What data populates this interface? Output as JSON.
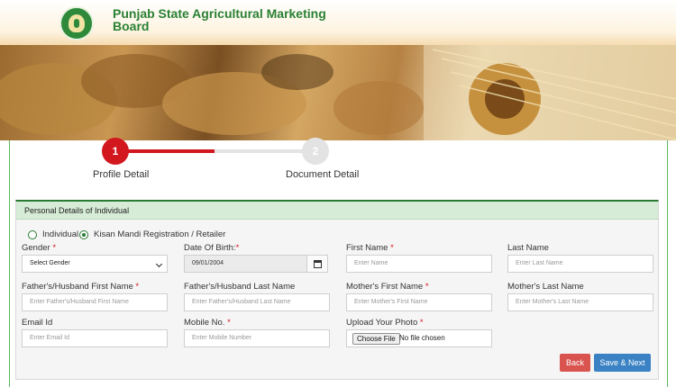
{
  "header": {
    "title": "Punjab State Agricultural Marketing Board"
  },
  "wizard": {
    "steps": [
      {
        "number": "1",
        "label": "Profile Detail"
      },
      {
        "number": "2",
        "label": "Document Detail"
      }
    ]
  },
  "form": {
    "panel_title": "Personal Details of Individual",
    "radio_options": [
      "Individual",
      "Kisan Mandi Registration / Retailer"
    ],
    "fields": {
      "gender": {
        "label": "Gender",
        "value": "Select Gender"
      },
      "dob": {
        "label": "Date Of Birth:",
        "value": "09/01/2004"
      },
      "first_name": {
        "label": "First Name",
        "placeholder": "Enter Name"
      },
      "last_name": {
        "label": "Last Name",
        "placeholder": "Enter Last Name"
      },
      "father_first": {
        "label": "Father's/Husband First Name",
        "placeholder": "Enter Father's/Husband First Name"
      },
      "father_last": {
        "label": "Father's/Husband Last Name",
        "placeholder": "Enter Father's/Husband Last Name"
      },
      "mother_first": {
        "label": "Mother's First Name",
        "placeholder": "Enter Mother's First Name"
      },
      "mother_last": {
        "label": "Mother's Last Name",
        "placeholder": "Enter Mother's Last Name"
      },
      "email": {
        "label": "Email Id",
        "placeholder": "Enter Email Id"
      },
      "mobile": {
        "label": "Mobile No.",
        "placeholder": "Enter Mobile Number"
      },
      "photo": {
        "label": "Upload Your Photo",
        "button": "Choose File",
        "status": "No file chosen"
      }
    },
    "required_mark": "*",
    "buttons": {
      "back": "Back",
      "next": "Save & Next"
    }
  },
  "colors": {
    "brand_green": "#2a8033",
    "active_step": "#d3171f",
    "back_button": "#d9534f",
    "next_button": "#3a82c4"
  },
  "icons": [
    "logo-emblem",
    "calendar-icon",
    "chevron-down-icon"
  ]
}
